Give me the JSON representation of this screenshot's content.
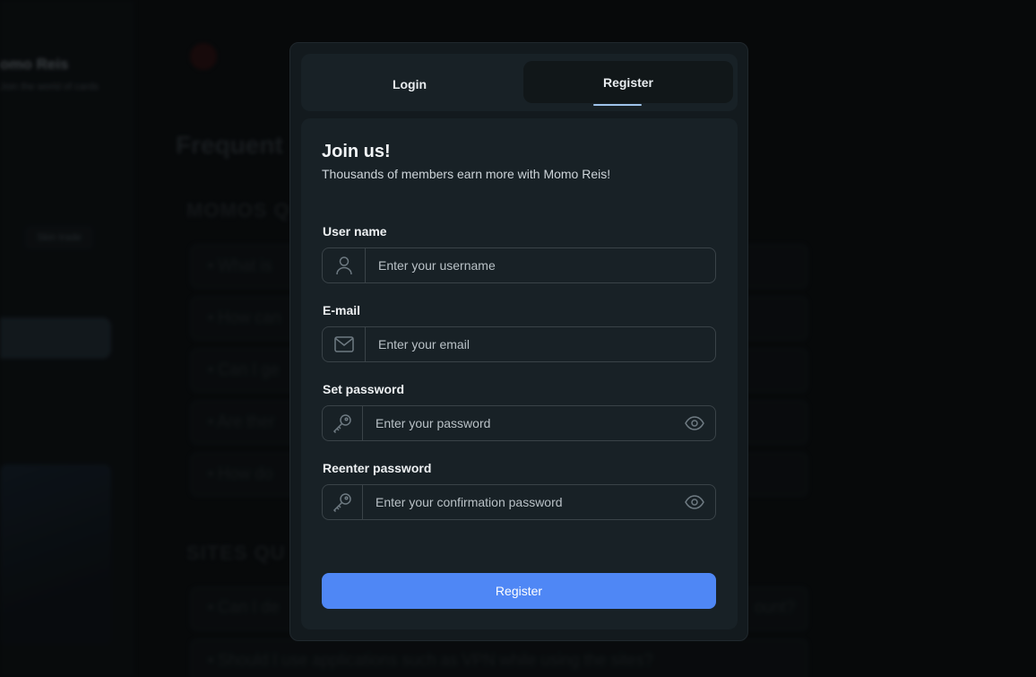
{
  "background": {
    "brand_name": "omo Reis",
    "brand_sub": "Join the world of cards",
    "sidebar_chip": "Skin trade",
    "page_heading": "Frequent",
    "section_1": "MOMOS Q",
    "section_2": "SITES QU",
    "faq_1": "• What is",
    "faq_2": "• How can",
    "faq_3": "• Can I ge",
    "faq_4": "• Are ther",
    "faq_5": "• How do",
    "faq_6": "• Can I de",
    "faq_6_tail": "ount?",
    "faq_7": "• Should I use applications such as VPN while using the sites?"
  },
  "tabs": {
    "login": "Login",
    "register": "Register"
  },
  "form": {
    "title": "Join us!",
    "subtitle": "Thousands of members earn more with Momo Reis!",
    "username": {
      "label": "User name",
      "placeholder": "Enter your username",
      "icon": "user-icon"
    },
    "email": {
      "label": "E-mail",
      "placeholder": "Enter your email",
      "icon": "mail-icon"
    },
    "password": {
      "label": "Set password",
      "placeholder": "Enter your password",
      "icon": "key-icon"
    },
    "confirm": {
      "label": "Reenter password",
      "placeholder": "Enter your confirmation password",
      "icon": "key-icon"
    },
    "submit": "Register"
  },
  "colors": {
    "accent": "#4f87f5",
    "tab_underline": "#9fc3ea",
    "modal_bg": "#131a1e"
  }
}
